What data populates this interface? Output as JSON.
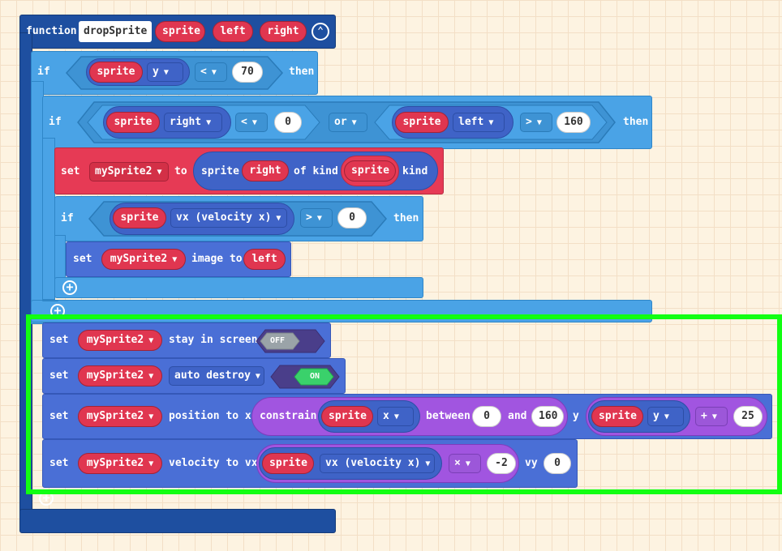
{
  "function": {
    "keyword": "function",
    "name": "dropSprite",
    "params": [
      "sprite",
      "left",
      "right"
    ]
  },
  "outer_if": {
    "kw_if": "if",
    "sprite": "sprite",
    "prop": "y",
    "op": "<",
    "value": "70",
    "kw_then": "then"
  },
  "inner_if": {
    "kw_if": "if",
    "sprite_a": "sprite",
    "prop_a": "right",
    "op_a": "<",
    "value_a": "0",
    "logic": "or",
    "sprite_b": "sprite",
    "prop_b": "left",
    "op_b": ">",
    "value_b": "160",
    "kw_then": "then"
  },
  "set_sprite": {
    "kw_set": "set",
    "var": "mySprite2",
    "kw_to": "to",
    "kw_sprite": "sprite",
    "arg": "right",
    "kw_of_kind": "of kind",
    "kind_var": "sprite",
    "kw_kind": "kind"
  },
  "vx_if": {
    "kw_if": "if",
    "sprite": "sprite",
    "prop": "vx (velocity x)",
    "op": ">",
    "value": "0",
    "kw_then": "then"
  },
  "set_image": {
    "kw_set": "set",
    "var": "mySprite2",
    "kw_image_to": "image to",
    "arg": "left"
  },
  "stay_in_screen": {
    "kw_set": "set",
    "var": "mySprite2",
    "flag": "stay in screen",
    "toggle": "OFF"
  },
  "auto_destroy": {
    "kw_set": "set",
    "var": "mySprite2",
    "flag": "auto destroy",
    "toggle": "ON"
  },
  "position": {
    "kw_set": "set",
    "var": "mySprite2",
    "kw_position_to_x": "position to x",
    "kw_constrain": "constrain",
    "sprite_x": "sprite",
    "prop_x": "x",
    "kw_between": "between",
    "min": "0",
    "kw_and": "and",
    "max": "160",
    "kw_y": "y",
    "sprite_y": "sprite",
    "prop_y": "y",
    "op": "+",
    "addend": "25"
  },
  "velocity": {
    "kw_set": "set",
    "var": "mySprite2",
    "kw_velocity_to_vx": "velocity to vx",
    "sprite": "sprite",
    "prop": "vx (velocity x)",
    "op": "×",
    "factor": "-2",
    "kw_vy": "vy",
    "vy": "0"
  },
  "icons": {
    "collapse": "chevron-up-icon",
    "add": "plus-circle-icon",
    "dropdown": "caret-down-icon"
  },
  "colors": {
    "function_block": "#1e4fa0",
    "logic_block": "#4aa3e6",
    "sprites_block": "#4a6fd6",
    "variable_pill": "#e03650",
    "math_block": "#a155e0",
    "highlight": "#12ff12"
  }
}
